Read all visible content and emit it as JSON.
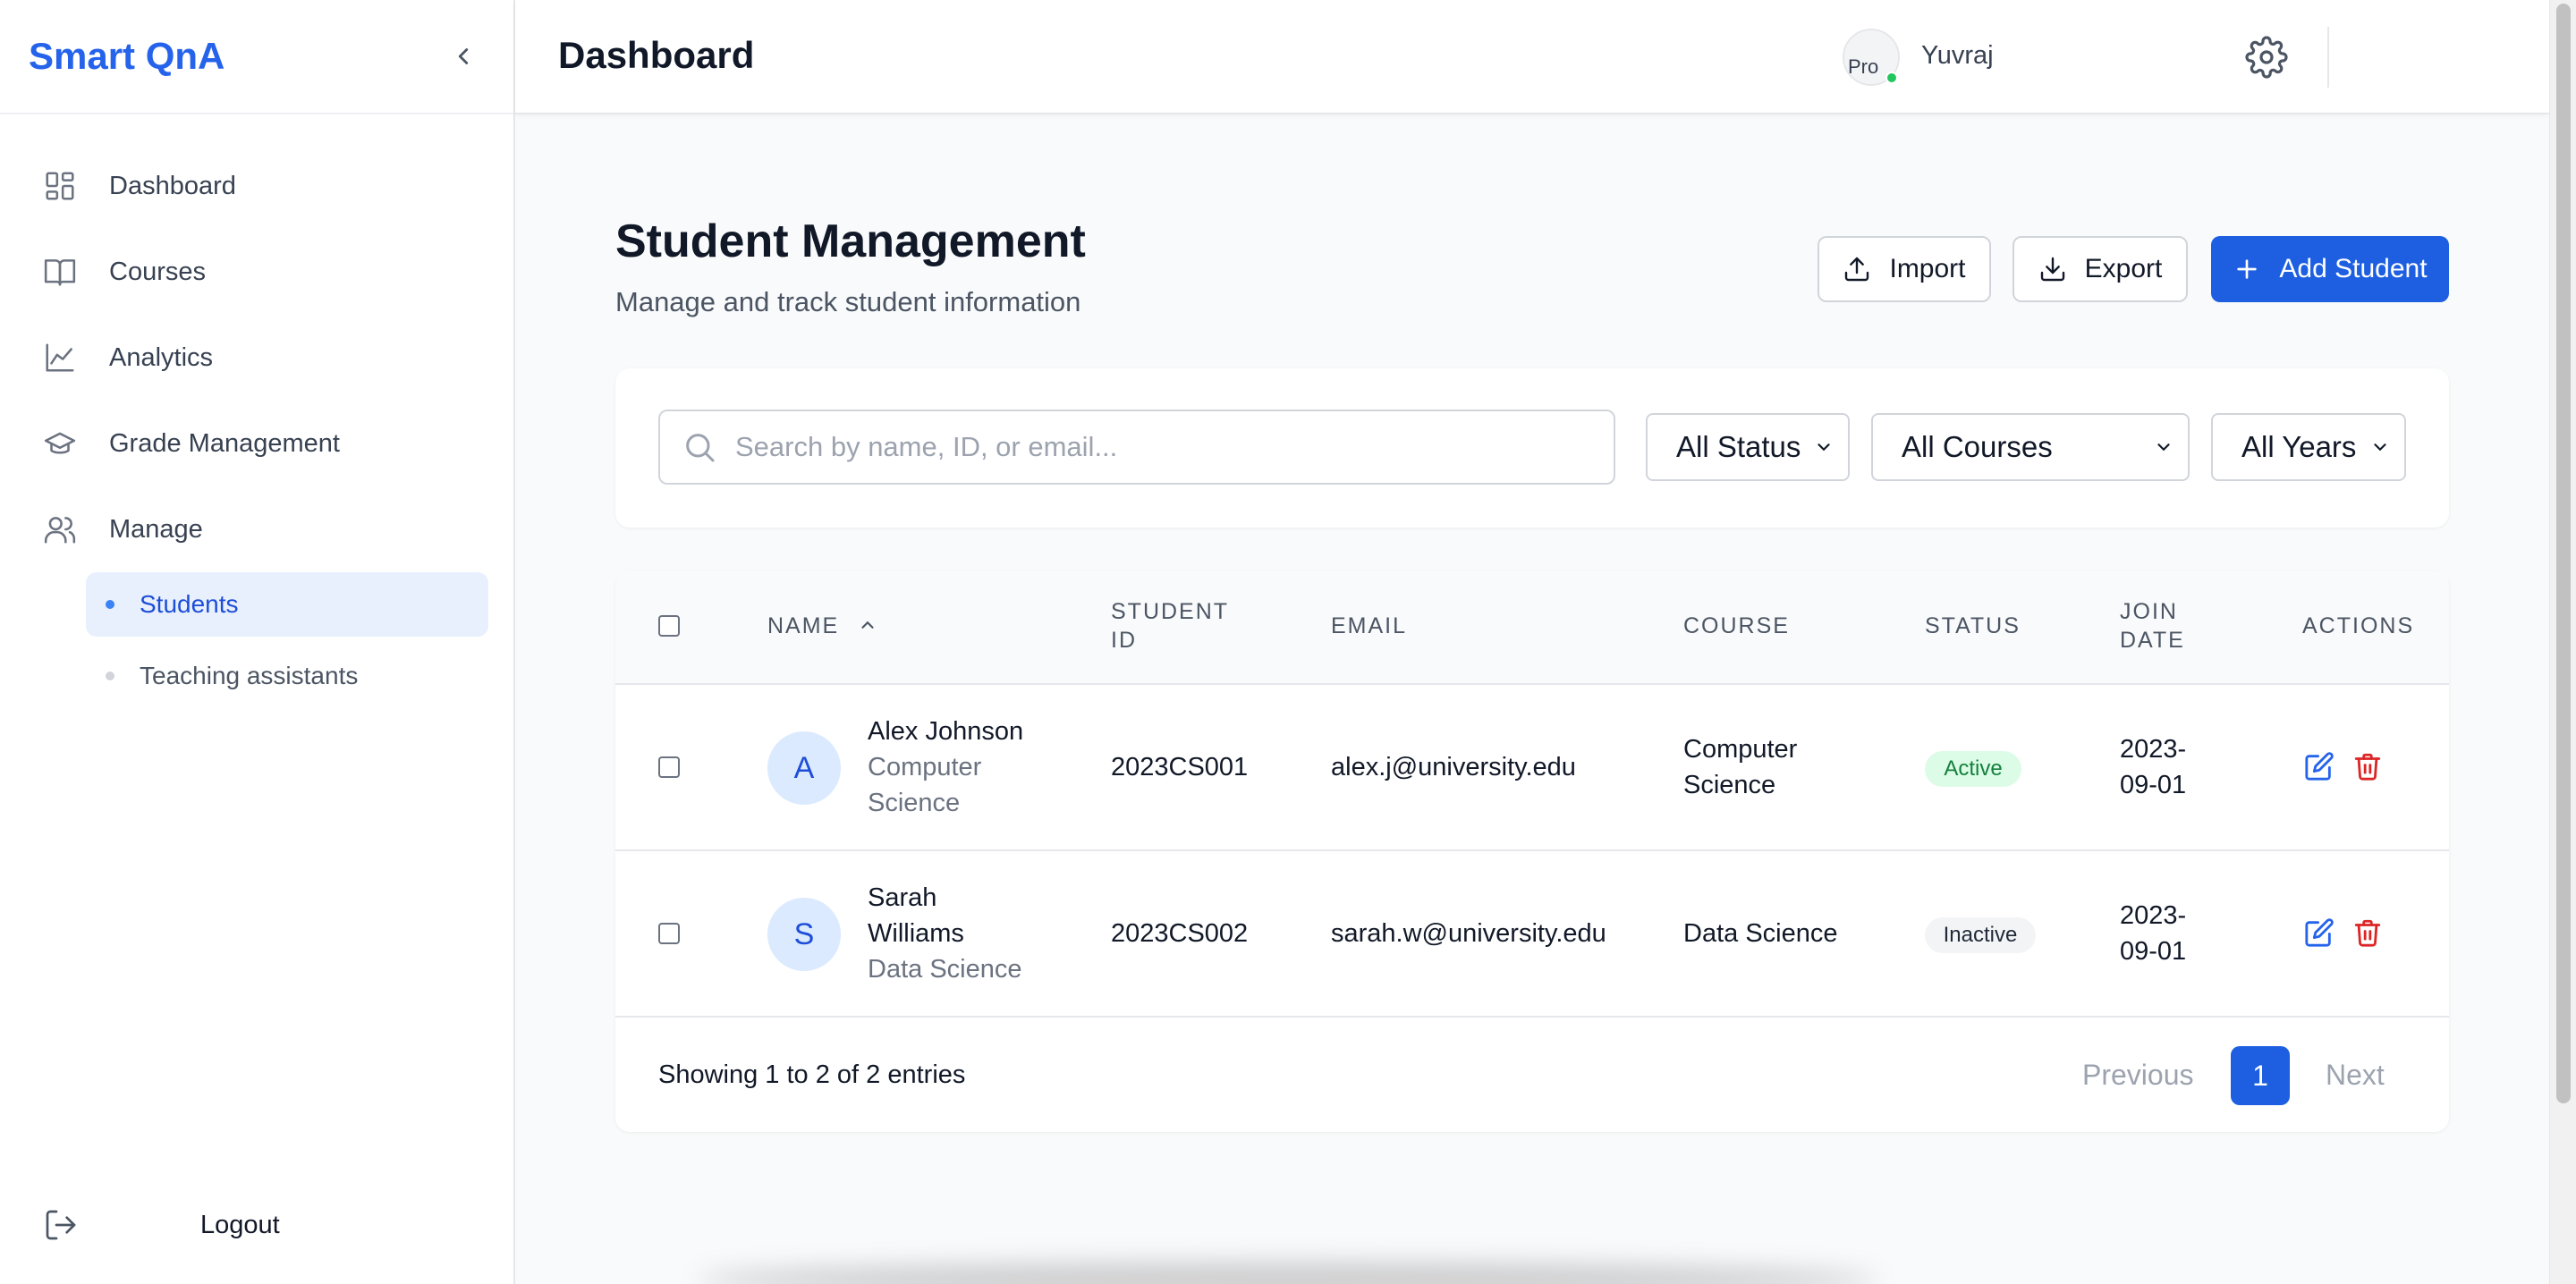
{
  "sidebar": {
    "brand": "Smart QnA",
    "items": [
      {
        "label": "Dashboard",
        "icon": "dashboard-grid-icon"
      },
      {
        "label": "Courses",
        "icon": "book-open-icon"
      },
      {
        "label": "Analytics",
        "icon": "line-chart-icon"
      },
      {
        "label": "Grade Management",
        "icon": "graduation-cap-icon"
      },
      {
        "label": "Manage",
        "icon": "users-icon"
      }
    ],
    "subitems": [
      {
        "label": "Students",
        "active": true
      },
      {
        "label": "Teaching assistants",
        "active": false
      }
    ],
    "logout": "Logout"
  },
  "header": {
    "title": "Dashboard",
    "avatar_alt": "Pro",
    "username": "Yuvraj"
  },
  "main": {
    "title": "Student Management",
    "subtitle": "Manage and track student information",
    "import_label": "Import",
    "export_label": "Export",
    "add_label": "Add Student",
    "search_placeholder": "Search by name, ID, or email...",
    "filters": {
      "status": "All Status",
      "courses": "All Courses",
      "years": "All Years"
    }
  },
  "table": {
    "columns": {
      "name": "NAME",
      "student_id_1": "STUDENT",
      "student_id_2": "ID",
      "email": "EMAIL",
      "course": "COURSE",
      "status": "STATUS",
      "join_1": "JOIN",
      "join_2": "DATE",
      "actions": "ACTIONS"
    },
    "rows": [
      {
        "initial": "A",
        "name_1": "Alex Johnson",
        "name_2": "",
        "program_1": "Computer",
        "program_2": "Science",
        "student_id": "2023CS001",
        "email": "alex.j@university.edu",
        "course_1": "Computer",
        "course_2": "Science",
        "status": "Active",
        "join_1": "2023-",
        "join_2": "09-01"
      },
      {
        "initial": "S",
        "name_1": "Sarah",
        "name_2": "Williams",
        "program_1": "Data Science",
        "program_2": "",
        "student_id": "2023CS002",
        "email": "sarah.w@university.edu",
        "course_1": "Data Science",
        "course_2": "",
        "status": "Inactive",
        "join_1": "2023-",
        "join_2": "09-01"
      }
    ],
    "footer": {
      "showing": "Showing 1 to 2 of 2 entries",
      "prev": "Previous",
      "page": "1",
      "next": "Next"
    }
  },
  "colors": {
    "brand": "#2563eb",
    "primary_button": "#1d5fe0",
    "active_nav_bg": "#e8f0fd",
    "active_badge_bg": "#dcfce7",
    "delete_icon": "#dc2626"
  }
}
